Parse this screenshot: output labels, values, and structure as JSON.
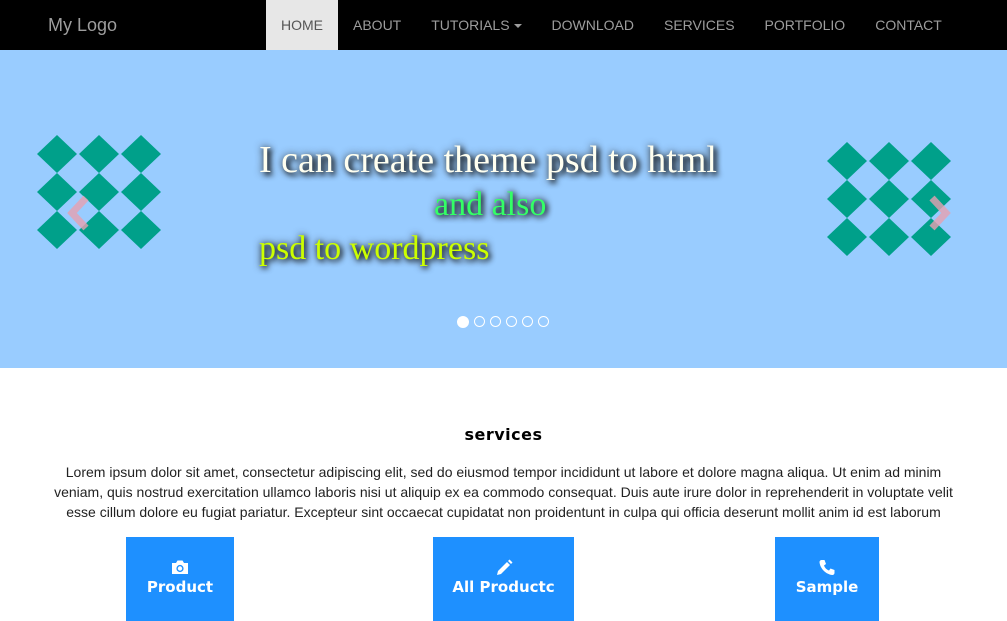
{
  "nav": {
    "brand": "My Logo",
    "items": [
      {
        "label": "HOME",
        "active": true
      },
      {
        "label": "ABOUT"
      },
      {
        "label": "TUTORIALS",
        "dropdown": true
      },
      {
        "label": "DOWNLOAD"
      },
      {
        "label": "SERVICES"
      },
      {
        "label": "PORTFOLIO"
      },
      {
        "label": "CONTACT"
      }
    ]
  },
  "carousel": {
    "caption_line1": "I can create theme psd to html",
    "caption_line2": "and also",
    "caption_line3": "psd to wordpress",
    "slide_count": 6,
    "active_slide": 1,
    "background_color": "#99ccff",
    "pattern_color": "#00a08a",
    "prev_icon": "chevron-left-icon",
    "next_icon": "chevron-right-icon"
  },
  "services": {
    "title": "services",
    "text": "Lorem ipsum dolor sit amet, consectetur adipiscing elit, sed do eiusmod tempor incididunt ut labore et dolore magna aliqua. Ut enim ad minim veniam, quis nostrud exercitation ullamco laboris nisi ut aliquip ex ea commodo consequat. Duis aute irure dolor in reprehenderit in voluptate velit esse cillum dolore eu fugiat pariatur. Excepteur sint occaecat cupidatat non proidentunt in culpa qui officia deserunt mollit anim id est laborum",
    "buttons": [
      {
        "label": "Product",
        "icon": "camera-icon"
      },
      {
        "label": "All Productc",
        "icon": "pencil-icon"
      },
      {
        "label": "Sample",
        "icon": "phone-icon"
      }
    ],
    "button_color": "#1e90ff"
  }
}
